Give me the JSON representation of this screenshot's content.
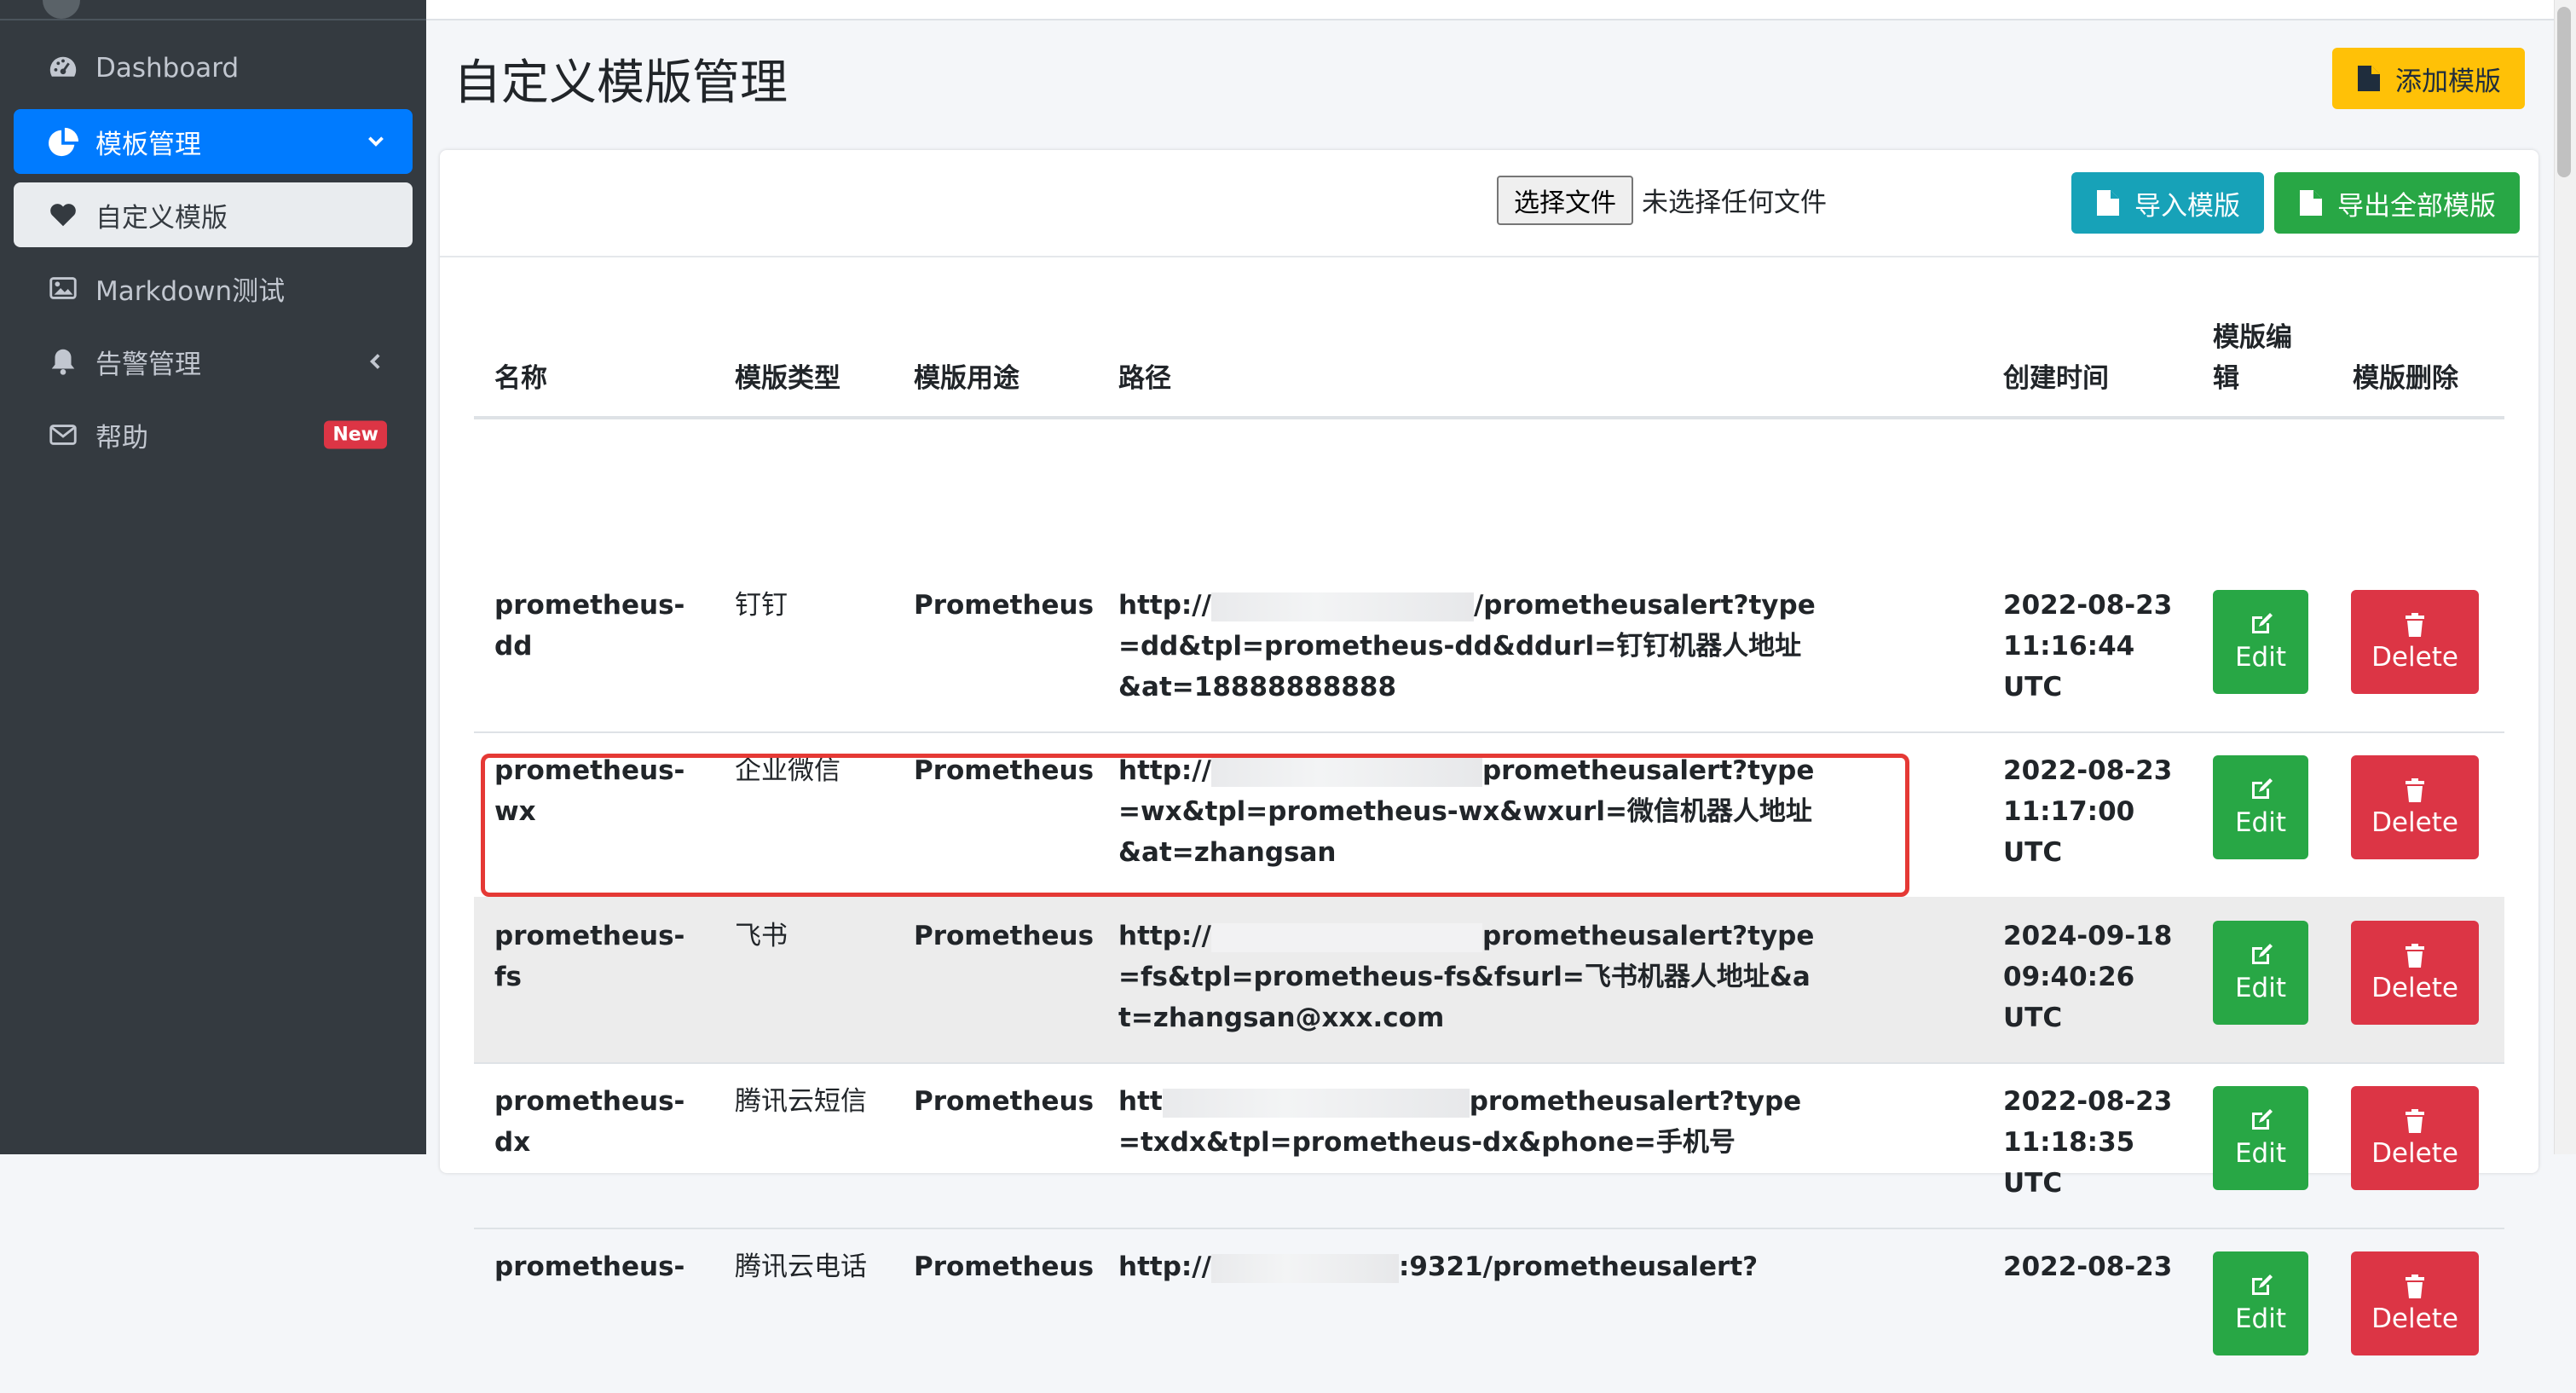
{
  "sidebar": {
    "items": [
      {
        "label": "Dashboard"
      },
      {
        "label": "模板管理"
      },
      {
        "label": "自定义模版"
      },
      {
        "label": "Markdown测试"
      },
      {
        "label": "告警管理"
      },
      {
        "label": "帮助",
        "badge": "New"
      }
    ]
  },
  "page": {
    "title": "自定义模版管理",
    "add_button": "添加模版"
  },
  "toolbar": {
    "file_button": "选择文件",
    "file_status": "未选择任何文件",
    "import_button": "导入模版",
    "export_button": "导出全部模版"
  },
  "table": {
    "headers": {
      "name": "名称",
      "type": "模版类型",
      "use": "模版用途",
      "path": "路径",
      "created": "创建时间",
      "edit": "模版编辑",
      "delete": "模版删除"
    },
    "action_labels": {
      "edit": "Edit",
      "delete": "Delete"
    },
    "rows": [
      {
        "name": "prometheus-dd",
        "type": "钉钉",
        "use": "Prometheus",
        "path_start": "http://",
        "path_end": "/prometheusalert?type=dd&tpl=prometheus-dd&ddurl=钉钉机器人地址&at=18888888888",
        "created": "2022-08-23 11:16:44 UTC"
      },
      {
        "name": "prometheus-wx",
        "type": "企业微信",
        "use": "Prometheus",
        "path_start": "http://",
        "path_end": "prometheusalert?type=wx&tpl=prometheus-wx&wxurl=微信机器人地址&at=zhangsan",
        "created": "2022-08-23 11:17:00 UTC"
      },
      {
        "name": "prometheus-fs",
        "type": "飞书",
        "use": "Prometheus",
        "path_start": "http://",
        "path_end": "prometheusalert?type=fs&tpl=prometheus-fs&fsurl=飞书机器人地址&at=zhangsan@xxx.com",
        "created": "2024-09-18 09:40:26 UTC"
      },
      {
        "name": "prometheus-dx",
        "type": "腾讯云短信",
        "use": "Prometheus",
        "path_start": "htt",
        "path_end": "prometheusalert?type=txdx&tpl=prometheus-dx&phone=手机号",
        "created": "2022-08-23 11:18:35 UTC"
      },
      {
        "name": "prometheus-",
        "type": "腾讯云电话",
        "use": "Prometheus",
        "path_start": "http://",
        "path_end": ":9321/prometheusalert?",
        "created": "2022-08-23"
      }
    ]
  },
  "colors": {
    "sidebar_bg": "#343a40",
    "primary": "#007bff",
    "warning": "#ffc107",
    "info": "#17a2b8",
    "success": "#28a745",
    "danger": "#dc3545",
    "highlight_box": "#e53935"
  },
  "icons": {
    "dashboard": "tachometer-icon",
    "templates": "pie-chart-icon",
    "custom": "heart-icon",
    "markdown": "image-icon",
    "alerts": "bell-icon",
    "help": "envelope-icon",
    "file": "file-icon",
    "edit": "edit-icon",
    "delete": "trash-icon"
  }
}
